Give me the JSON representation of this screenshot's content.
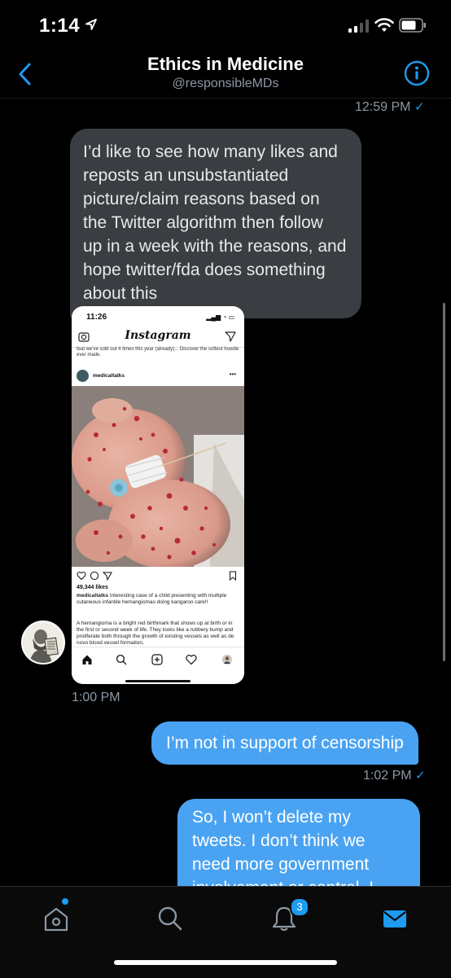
{
  "status": {
    "time": "1:14"
  },
  "header": {
    "title": "Ethics in Medicine",
    "handle": "@responsibleMDs"
  },
  "messages": {
    "ts_top": "12:59 PM",
    "incoming_text": "I’d like to see how many likes and reposts an unsubstantiated picture/claim reasons based on the Twitter algorithm then follow up in a week with the reasons, and hope twitter/fda does something about this",
    "ts_incoming": "1:00 PM",
    "out1": "I’m not in support of censorship",
    "ts_out1": "1:02 PM",
    "out2": "So, I won’t delete my tweets. I don’t think we need more government involvement or control. I don’t think Twitter or"
  },
  "shot": {
    "time": "11:26",
    "app": "Instagram",
    "top_caption": "feat we've sold out 4 times this year (already)... Discover the softest hoodie ever made.",
    "username": "medicaltalks",
    "likes": "49,344 likes",
    "caption_user": "medicaltalks",
    "caption_text": "Interesting case of a child presenting with multiple cutaneous infantile hemangiomas doing kangaroo care!!",
    "caption_more": "A hemangioma is a bright red birthmark that shows up at birth or in the first or second week of life. They looks like a rubbery bump and proliferate both through the growth of existing vessels as well as de novo blood vessel formation,"
  },
  "tabs": {
    "notifications_badge": "3"
  },
  "colors": {
    "accent": "#1d9bf0",
    "outgoing_bubble": "#4aa3f2",
    "incoming_bubble": "#3a3d41"
  },
  "icons": [
    "location-arrow-icon",
    "signal-icon",
    "wifi-icon",
    "battery-icon",
    "back-chevron-icon",
    "info-icon",
    "home-icon",
    "search-icon",
    "bell-icon",
    "mail-icon"
  ]
}
